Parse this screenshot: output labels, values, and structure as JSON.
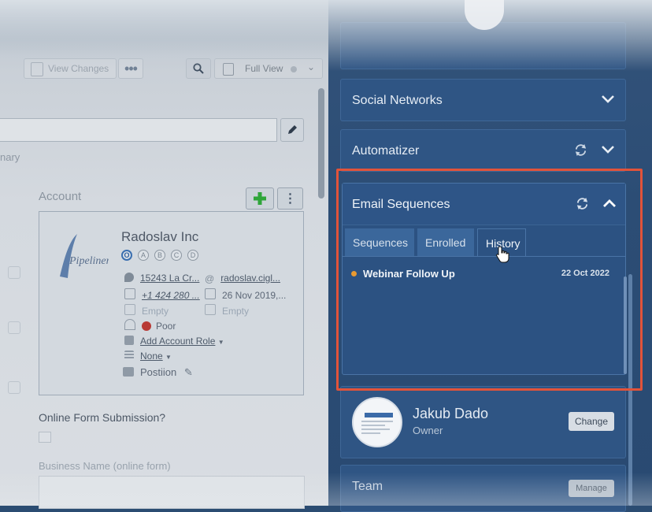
{
  "toolbar": {
    "view_changes_label": "View Changes",
    "more_label": "•••",
    "view_mode_label": "Full View"
  },
  "left": {
    "summary_label": "nary",
    "account": {
      "section_label": "Account",
      "company_name": "Radoslav Inc",
      "stages": [
        "O",
        "A",
        "B",
        "C",
        "D"
      ],
      "address": "15243 La Cr...",
      "email": "radoslav.cigl...",
      "phone": "+1 424 280 ...",
      "date": "26 Nov 2019,...",
      "empty_left": "Empty",
      "empty_right": "Empty",
      "rating": "Poor",
      "add_role": "Add Account Role",
      "role_value": "None",
      "position": "Postiion"
    },
    "form_question": "Online Form Submission?",
    "business_name_label": "Business Name (online form)"
  },
  "right": {
    "panels": {
      "social_networks": "Social Networks",
      "automatizer": "Automatizer",
      "email_sequences": "Email Sequences"
    },
    "tabs": [
      "Sequences",
      "Enrolled",
      "History"
    ],
    "active_tab": "History",
    "history": [
      {
        "name": "Webinar Follow Up",
        "date": "22 Oct 2022"
      }
    ],
    "owner": {
      "name": "Jakub Dado",
      "role": "Owner",
      "change_label": "Change"
    },
    "team": {
      "title": "Team",
      "manage_label": "Manage"
    }
  },
  "colors": {
    "highlight": "#e2533a",
    "history_dot": "#e89a32",
    "poor_rating": "#b83a35",
    "add_icon": "#2fa53a"
  }
}
